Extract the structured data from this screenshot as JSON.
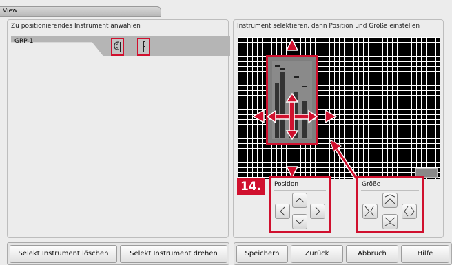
{
  "window": {
    "tab_label": "View"
  },
  "left_panel": {
    "header": "Zu positionierendes Instrument anwählen",
    "instrument_label": "GRP-1"
  },
  "right_panel": {
    "header": "Instrument selektieren, dann Position und Größe einstellen"
  },
  "callout": {
    "label": "14."
  },
  "position_group": {
    "title": "Position"
  },
  "size_group": {
    "title": "Größe"
  },
  "buttons": {
    "delete": "Selekt Instrument löschen",
    "rotate": "Selekt Instrument drehen",
    "save": "Speichern",
    "back": "Zurück",
    "cancel": "Abbruch",
    "help": "Hilfe"
  },
  "colors": {
    "highlight": "#d0102e",
    "grid_bg": "#000000",
    "grid_line": "#ffffff"
  }
}
